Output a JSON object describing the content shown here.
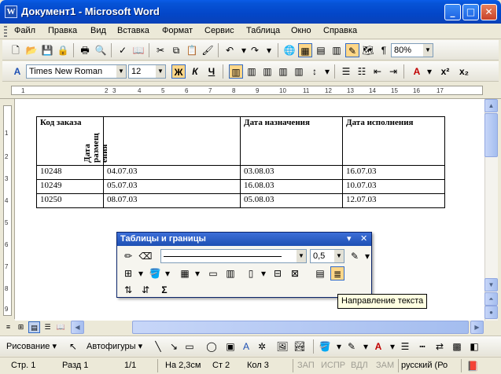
{
  "window": {
    "title": "Документ1 - Microsoft Word",
    "app_icon": "W"
  },
  "menu": [
    "Файл",
    "Правка",
    "Вид",
    "Вставка",
    "Формат",
    "Сервис",
    "Таблица",
    "Окно",
    "Справка"
  ],
  "standard_toolbar": {
    "zoom": "80%"
  },
  "format_toolbar": {
    "style_glyph": "A",
    "font": "Times New Roman",
    "size": "12",
    "bold": "Ж",
    "italic": "К",
    "underline": "Ч"
  },
  "ruler": {
    "h_ticks": [
      "1",
      "2",
      "3",
      "4",
      "5",
      "6",
      "7",
      "8",
      "9",
      "10",
      "11",
      "12",
      "13",
      "14",
      "15",
      "16",
      "17"
    ],
    "v_ticks": [
      "1",
      "2",
      "3",
      "4",
      "5",
      "6",
      "7",
      "8",
      "9"
    ]
  },
  "table": {
    "headers": [
      "Код заказа",
      "Дата\nразмещ\nения",
      "Дата назначения",
      "Дата исполнения"
    ],
    "rows": [
      [
        "10248",
        "04.07.03",
        "03.08.03",
        "16.07.03"
      ],
      [
        "10249",
        "05.07.03",
        "16.08.03",
        "10.07.03"
      ],
      [
        "10250",
        "08.07.03",
        "05.08.03",
        "12.07.03"
      ]
    ]
  },
  "tables_toolbar": {
    "title": "Таблицы и границы",
    "line_weight": "0,5",
    "sigma": "Σ"
  },
  "tooltip": "Направление текста",
  "drawing_toolbar": {
    "draw_label": "Рисование",
    "autoshapes_label": "Автофигуры"
  },
  "status": {
    "page": "Стр. 1",
    "section": "Разд 1",
    "pages": "1/1",
    "position": "На 2,3см",
    "line": "Ст 2",
    "column": "Кол 3",
    "rec": "ЗАП",
    "trk": "ИСПР",
    "ext": "ВДЛ",
    "ovr": "ЗАМ",
    "language": "русский (Ро"
  }
}
